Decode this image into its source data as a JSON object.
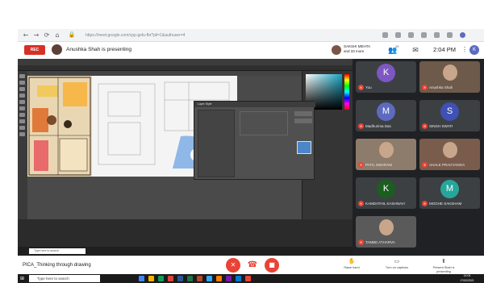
{
  "browser": {
    "url": "https://meet.google.com/cpp-gsfu-fbr?pli=1&authuser=4",
    "nav_back": "←",
    "nav_forward": "→",
    "nav_reload": "⟳",
    "nav_home": "⌂"
  },
  "meet": {
    "rec_label": "REC",
    "presenting_text": "Anushka Shah is presenting",
    "joined_text": "SAKSHI MEHTA and 33 more",
    "people_count": "35",
    "time": "2:04 PM",
    "self_initial": "K",
    "meeting_title": "PICA_Thinking through drawing",
    "controls": {
      "mic_icon": "mic-off-icon",
      "end_call_icon": "end-call-icon",
      "camera_icon": "camera-off-icon"
    },
    "raise_hand_label": "Raise hand",
    "captions_label": "Turn on captions",
    "present_label": "Present Shah is presenting"
  },
  "participants": [
    {
      "name": "You",
      "initial": "K",
      "color": "#7e57c2",
      "type": "initial"
    },
    {
      "name": "Anushka Shah",
      "initial": "",
      "color": "#6d5a4a",
      "type": "photo"
    },
    {
      "name": "Madhurima Das",
      "initial": "M",
      "color": "#5c6bc0",
      "type": "initial"
    },
    {
      "name": "SINGH SWATI",
      "initial": "S",
      "color": "#3f51b5",
      "type": "initial"
    },
    {
      "name": "PATIL SWARAM",
      "initial": "",
      "color": "#8d7b6b",
      "type": "photo"
    },
    {
      "name": "AHALE PRAGYANGA",
      "initial": "",
      "color": "#7a5c4d",
      "type": "photo"
    },
    {
      "name": "KAMDATHIL KASHNAVI",
      "initial": "K",
      "color": "#1b5e20",
      "type": "initial"
    },
    {
      "name": "MOGHE SAKSHAM",
      "initial": "M",
      "color": "#26a69a",
      "type": "initial"
    },
    {
      "name": "TAMBE ATHARVA",
      "initial": "",
      "color": "#5a5a5a",
      "type": "photo"
    }
  ],
  "shared_screen": {
    "dialog_title": "Layer Style",
    "taskbar_search": "Type here to search"
  },
  "windows": {
    "search_placeholder": "Type here to search",
    "time": "14:04",
    "date": "17/02/2021"
  }
}
